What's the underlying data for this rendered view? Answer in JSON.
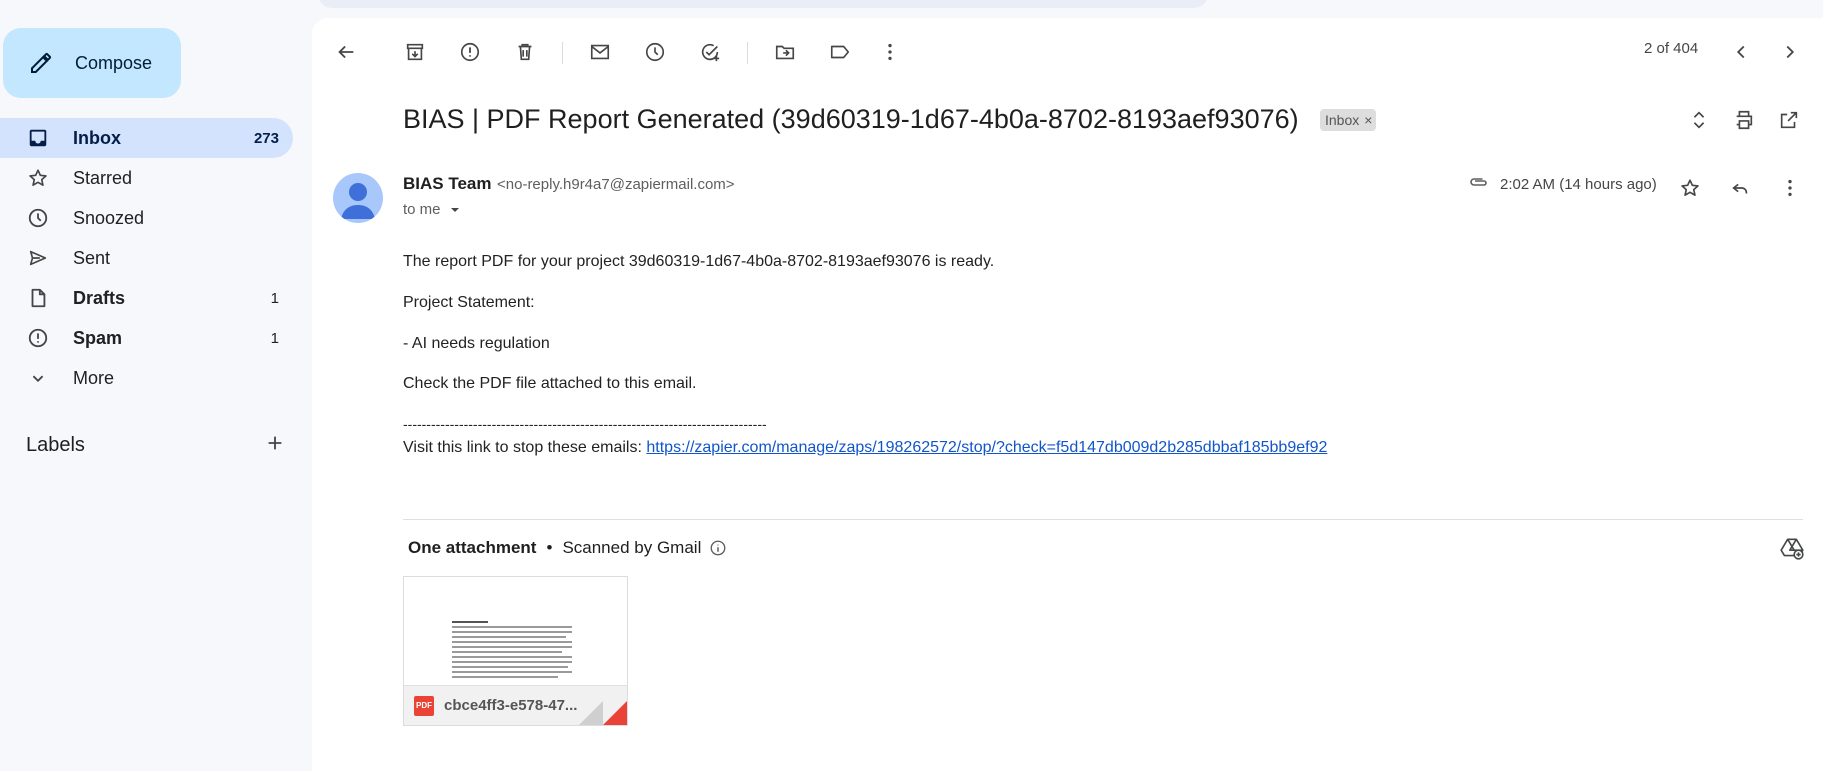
{
  "sidebar": {
    "compose_label": "Compose",
    "items": [
      {
        "label": "Inbox",
        "count": "273",
        "icon": "inbox-icon"
      },
      {
        "label": "Starred",
        "count": "",
        "icon": "star-icon"
      },
      {
        "label": "Snoozed",
        "count": "",
        "icon": "clock-icon"
      },
      {
        "label": "Sent",
        "count": "",
        "icon": "send-icon"
      },
      {
        "label": "Drafts",
        "count": "1",
        "icon": "draft-icon"
      },
      {
        "label": "Spam",
        "count": "1",
        "icon": "spam-icon"
      },
      {
        "label": "More",
        "count": "",
        "icon": "chevron-down-icon"
      }
    ],
    "labels_title": "Labels"
  },
  "toolbar": {
    "pager": "2 of 404"
  },
  "email": {
    "subject": "BIAS | PDF Report Generated (39d60319-1d67-4b0a-8702-8193aef93076)",
    "label_chip": "Inbox",
    "label_chip_close": "×",
    "sender_name": "BIAS Team",
    "sender_email": "<no-reply.h9r4a7@zapiermail.com>",
    "recipient": "to me",
    "timestamp": "2:02 AM (14 hours ago)",
    "body": {
      "line1": "The report PDF for your project 39d60319-1d67-4b0a-8702-8193aef93076 is ready.",
      "line2": "Project Statement:",
      "line3": "- AI needs regulation",
      "line4": "Check the PDF file attached to this email.",
      "separator": "------------------------------------------------------------------------------",
      "unsubscribe_prefix": "Visit this link to stop these emails: ",
      "unsubscribe_link": "https://zapier.com/manage/zaps/198262572/stop/?check=f5d147db009d2b285dbbaf185bb9ef92"
    }
  },
  "attachments": {
    "title": "One attachment",
    "dot": "•",
    "scan_note": "Scanned by Gmail",
    "file_name": "cbce4ff3-e578-47...",
    "file_type": "PDF"
  },
  "colors": {
    "accent": "#c2e7ff",
    "active_nav": "#d3e3fd",
    "link": "#1155cc",
    "pdf_red": "#ea4335"
  }
}
